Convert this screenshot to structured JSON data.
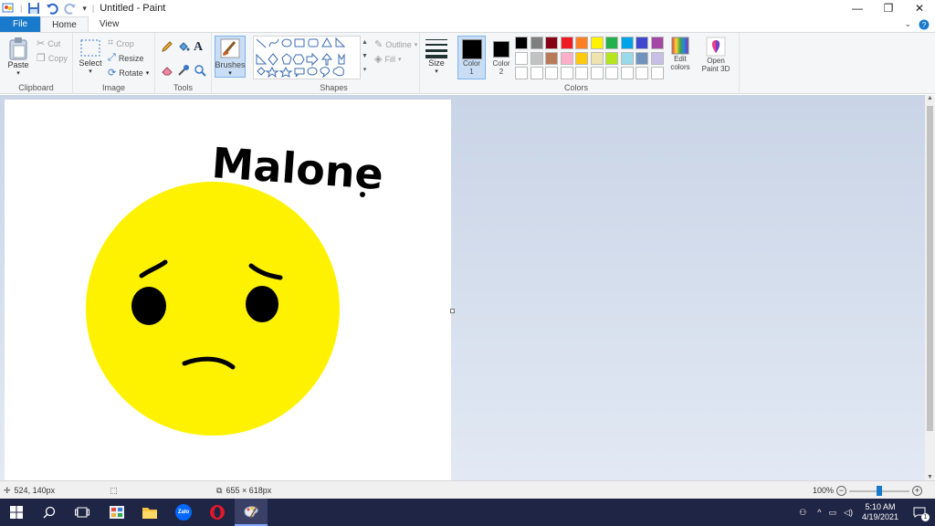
{
  "window": {
    "title": "Untitled - Paint",
    "minimize": "—",
    "restore": "❐",
    "close": "✕"
  },
  "tabs": {
    "file": "File",
    "home": "Home",
    "view": "View"
  },
  "ribbon": {
    "clipboard": {
      "label": "Clipboard",
      "paste": "Paste",
      "cut": "Cut",
      "copy": "Copy"
    },
    "image": {
      "label": "Image",
      "select": "Select",
      "crop": "Crop",
      "resize": "Resize",
      "rotate": "Rotate"
    },
    "tools": {
      "label": "Tools"
    },
    "brushes": {
      "label": "Brushes"
    },
    "shapes": {
      "label": "Shapes",
      "outline": "Outline",
      "fill": "Fill"
    },
    "size": {
      "label": "Size"
    },
    "colors": {
      "label": "Colors",
      "color1": "Color 1",
      "color1_line1": "Color",
      "color1_line2": "1",
      "color2_line1": "Color",
      "color2_line2": "2",
      "edit_line1": "Edit",
      "edit_line2": "colors",
      "color1_value": "#000000",
      "color2_value": "#ffffff",
      "palette_row1": [
        "#000000",
        "#7f7f7f",
        "#880015",
        "#ed1c24",
        "#ff7f27",
        "#fff200",
        "#22b14c",
        "#00a2e8",
        "#3f48cc",
        "#a349a4"
      ],
      "palette_row2": [
        "#ffffff",
        "#c3c3c3",
        "#b97a57",
        "#ffaec9",
        "#ffc90e",
        "#efe4b0",
        "#b5e61d",
        "#99d9ea",
        "#7092be",
        "#c8bfe7"
      ],
      "palette_row3": [
        "#ffffff",
        "#ffffff",
        "#ffffff",
        "#ffffff",
        "#ffffff",
        "#ffffff",
        "#ffffff",
        "#ffffff",
        "#ffffff",
        "#ffffff"
      ]
    },
    "paint3d": {
      "line1": "Open",
      "line2": "Paint 3D"
    }
  },
  "canvas": {
    "handwriting": "Malone",
    "face_color": "#fff200"
  },
  "status": {
    "cursor_pos": "524, 140px",
    "image_size": "655 × 618px",
    "zoom": "100%"
  },
  "taskbar": {
    "time": "5:10 AM",
    "date": "4/19/2021",
    "zalo": "Zalo",
    "notifications": "1"
  }
}
